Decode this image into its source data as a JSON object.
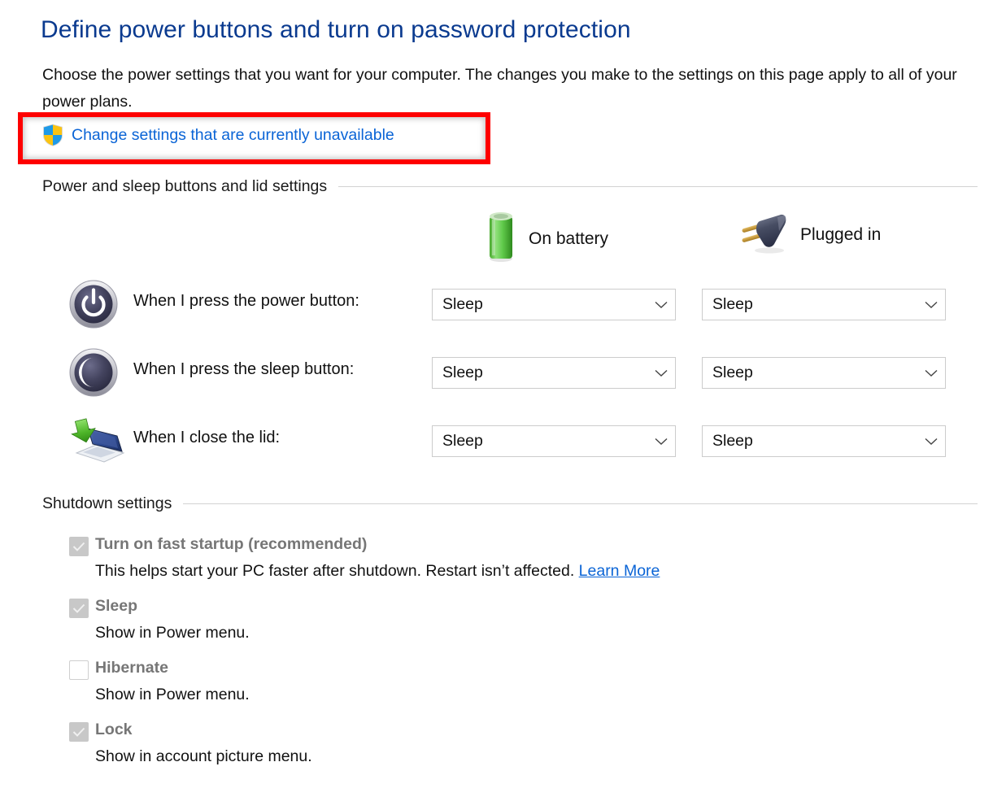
{
  "page": {
    "title": "Define power buttons and turn on password protection",
    "intro": "Choose the power settings that you want for your computer. The changes you make to the settings on this page apply to all of your power plans.",
    "uac_link": "Change settings that are currently unavailable",
    "uac_icon": "uac-shield-icon"
  },
  "colors": {
    "title_blue": "#0a3a8f",
    "link_blue": "#0a64d6",
    "highlight_red": "#fe0000",
    "disabled_gray": "#767676",
    "rule_gray": "#d2d2d2",
    "battery_green": "#5ec14b",
    "plug_gray": "#4a4f63"
  },
  "sections": {
    "power": {
      "header": "Power and sleep buttons and lid settings",
      "columns": [
        {
          "label": "On battery",
          "icon": "battery-icon"
        },
        {
          "label": "Plugged in",
          "icon": "power-plug-icon"
        }
      ],
      "rows": [
        {
          "icon": "power-button-icon",
          "label": "When I press the power button:",
          "on_battery": "Sleep",
          "plugged_in": "Sleep"
        },
        {
          "icon": "sleep-moon-icon",
          "label": "When I press the sleep button:",
          "on_battery": "Sleep",
          "plugged_in": "Sleep"
        },
        {
          "icon": "laptop-lid-close-icon",
          "label": "When I close the lid:",
          "on_battery": "Sleep",
          "plugged_in": "Sleep"
        }
      ]
    },
    "shutdown": {
      "header": "Shutdown settings",
      "items": [
        {
          "label": "Turn on fast startup (recommended)",
          "checked": true,
          "desc_before": "This helps start your PC faster after shutdown. Restart isn’t affected. ",
          "link": "Learn More"
        },
        {
          "label": "Sleep",
          "checked": true,
          "desc_before": "Show in Power menu.",
          "link": ""
        },
        {
          "label": "Hibernate",
          "checked": false,
          "desc_before": "Show in Power menu.",
          "link": ""
        },
        {
          "label": "Lock",
          "checked": true,
          "desc_before": "Show in account picture menu.",
          "link": ""
        }
      ]
    }
  }
}
